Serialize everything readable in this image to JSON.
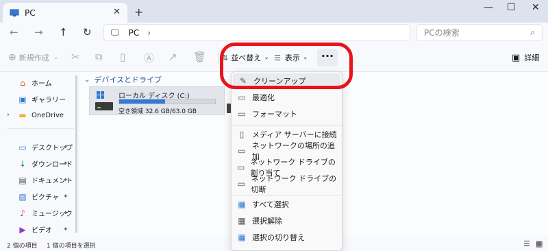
{
  "window": {
    "tab_title": "PC",
    "tab_close": "✕",
    "new_tab": "+",
    "controls": {
      "minimize": "—",
      "maximize": "☐",
      "close": "✕"
    }
  },
  "nav": {
    "back": "←",
    "forward": "→",
    "up": "↑",
    "refresh": "↻",
    "address": {
      "monitor_icon": "🖵",
      "location": "PC",
      "chevron": "›"
    },
    "search": {
      "placeholder": "PCの検索",
      "icon": "⌕"
    }
  },
  "commandbar": {
    "new_label": "新規作成",
    "sort_label": "並べ替え",
    "view_label": "表示",
    "more_label": "···",
    "details_label": "詳細"
  },
  "sidebar": {
    "items": [
      {
        "label": "ホーム",
        "icon": "home-icon",
        "glyph": "⌂"
      },
      {
        "label": "ギャラリー",
        "icon": "gallery-icon",
        "glyph": "▣"
      },
      {
        "label": "OneDrive",
        "icon": "folder-icon",
        "glyph": "▬"
      },
      {
        "label": "デスクトップ",
        "icon": "desktop-icon",
        "glyph": "▭",
        "pin": "📌"
      },
      {
        "label": "ダウンロード",
        "icon": "download-icon",
        "glyph": "↓",
        "pin": "📌"
      },
      {
        "label": "ドキュメント",
        "icon": "document-icon",
        "glyph": "▤",
        "pin": "📌"
      },
      {
        "label": "ピクチャ",
        "icon": "picture-icon",
        "glyph": "▨",
        "pin": "📌"
      },
      {
        "label": "ミュージック",
        "icon": "music-icon",
        "glyph": "♪",
        "pin": "📌"
      },
      {
        "label": "ビデオ",
        "icon": "video-icon",
        "glyph": "▶",
        "pin": "📌"
      }
    ]
  },
  "main": {
    "group_title": "デバイスとドライブ",
    "drive": {
      "name": "ローカル ディスク (C:)",
      "free_text": "空き領域 32.6 GB/63.0 GB",
      "used_fraction": 0.48
    }
  },
  "context_menu": {
    "items": [
      {
        "label": "クリーンアップ",
        "glyph": "✎"
      },
      {
        "label": "最適化",
        "glyph": "▭"
      },
      {
        "label": "フォーマット",
        "glyph": "▭"
      },
      {
        "label": "メディア サーバーに接続",
        "glyph": "▯"
      },
      {
        "label": "ネットワークの場所の追加",
        "glyph": "▭"
      },
      {
        "label": "ネットワーク ドライブの割り当て",
        "glyph": "▭"
      },
      {
        "label": "ネットワーク ドライブの切断",
        "glyph": "▭"
      },
      {
        "label": "すべて選択",
        "glyph": "▦"
      },
      {
        "label": "選択解除",
        "glyph": "▦"
      },
      {
        "label": "選択の切り替え",
        "glyph": "▦"
      }
    ]
  },
  "status": {
    "item_count": "2 個の項目",
    "selected": "1 個の項目を選択"
  },
  "colors": {
    "accent": "#2f7bd6",
    "annotation": "#e8141c"
  }
}
